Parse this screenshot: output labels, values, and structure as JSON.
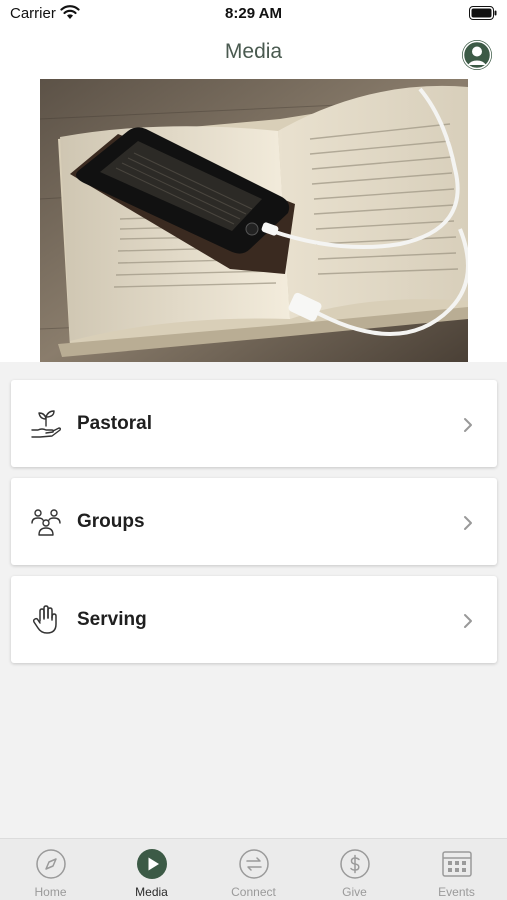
{
  "status_bar": {
    "carrier": "Carrier",
    "time": "8:29 AM"
  },
  "nav": {
    "title": "Media"
  },
  "hero": {
    "subject": "smartphone resting on an open bible"
  },
  "menu": [
    {
      "label": "Pastoral",
      "icon": "hand-plant-icon"
    },
    {
      "label": "Groups",
      "icon": "people-group-icon"
    },
    {
      "label": "Serving",
      "icon": "raised-hand-icon"
    }
  ],
  "tabs": [
    {
      "label": "Home",
      "icon": "compass-icon",
      "active": false
    },
    {
      "label": "Media",
      "icon": "play-icon",
      "active": true
    },
    {
      "label": "Connect",
      "icon": "arrows-exchange-icon",
      "active": false
    },
    {
      "label": "Give",
      "icon": "dollar-icon",
      "active": false
    },
    {
      "label": "Events",
      "icon": "calendar-icon",
      "active": false
    }
  ],
  "colors": {
    "accent": "#3c5a46",
    "inactive_tab": "#9a9a9a",
    "background": "#f2f2f2"
  }
}
